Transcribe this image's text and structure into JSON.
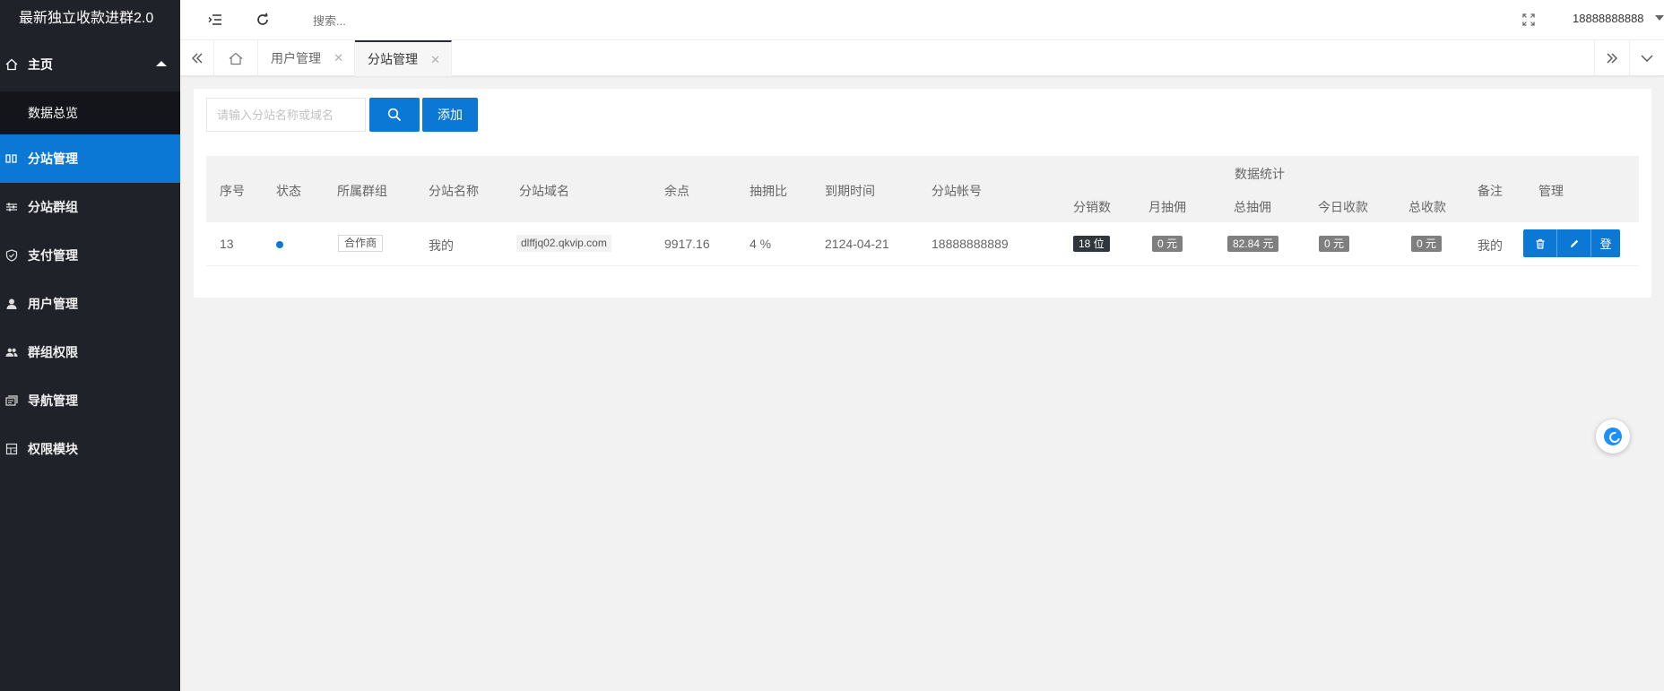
{
  "app": {
    "title": "最新独立收款进群2.0"
  },
  "sidebar": {
    "home": {
      "label": "主页",
      "icon": "home-icon"
    },
    "submenu": {
      "label": "数据总览"
    },
    "items": [
      {
        "label": "分站管理",
        "icon": "columns-icon",
        "active": true
      },
      {
        "label": "分站群组",
        "icon": "sliders-icon"
      },
      {
        "label": "支付管理",
        "icon": "shield-check-icon"
      },
      {
        "label": "用户管理",
        "icon": "user-icon"
      },
      {
        "label": "群组权限",
        "icon": "group-icon"
      },
      {
        "label": "导航管理",
        "icon": "nav-icon"
      },
      {
        "label": "权限模块",
        "icon": "module-icon"
      }
    ]
  },
  "header": {
    "search_placeholder": "搜索...",
    "username": "18888888888"
  },
  "tabs": [
    {
      "label": "用户管理",
      "active": false
    },
    {
      "label": "分站管理",
      "active": true
    }
  ],
  "toolbar": {
    "search_placeholder": "请输入分站名称或域名",
    "add_label": "添加"
  },
  "table": {
    "headers": {
      "index": "序号",
      "status": "状态",
      "group": "所属群组",
      "name": "分站名称",
      "domain": "分站域名",
      "balance": "余点",
      "commission_rate": "抽拥比",
      "expire": "到期时间",
      "account": "分站帐号",
      "stats_group": "数据统计",
      "sub_count": "分销数",
      "monthly_commission": "月抽佣",
      "total_commission": "总抽佣",
      "today_income": "今日收款",
      "total_income": "总收款",
      "remark": "备注",
      "manage": "管理"
    },
    "rows": [
      {
        "index": "13",
        "status": "active",
        "group": "合作商",
        "name": "我的",
        "domain": "dlffjq02.qkvip.com",
        "balance": "9917.16",
        "commission_rate": "4 %",
        "expire": "2124-04-21",
        "account": "18888888889",
        "sub_count": "18 位",
        "monthly_commission": "0 元",
        "total_commission": "82.84 元",
        "today_income": "0 元",
        "total_income": "0 元",
        "remark": "我的",
        "login_label": "登"
      }
    ]
  },
  "colors": {
    "accent": "#0a78d4",
    "sidebar_bg": "#20222a",
    "badge_dark": "#2f363c",
    "badge_gray": "#7f7f7f"
  }
}
